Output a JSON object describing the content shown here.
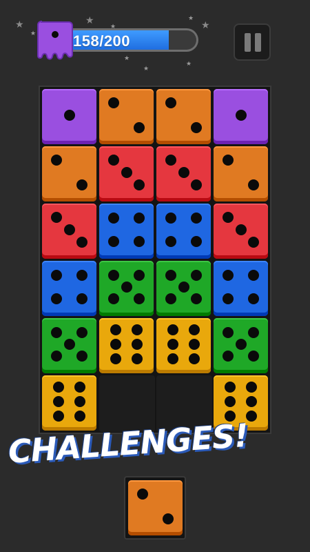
{
  "hud": {
    "progress_label": "158/200",
    "progress_current": 158,
    "progress_total": 200,
    "progress_color": "#2f86f5",
    "level_icon": "purple-jelly-die-icon",
    "pause_icon": "pause-icon"
  },
  "colors": {
    "purple": "#9a4fe0",
    "orange": "#e07a22",
    "red": "#e5373f",
    "blue": "#1f67e2",
    "green": "#1fa827",
    "yellow": "#e9a80c"
  },
  "board": {
    "columns": 4,
    "rows": [
      [
        {
          "color": "purple",
          "value": 1
        },
        {
          "color": "orange",
          "value": 2
        },
        {
          "color": "orange",
          "value": 2
        },
        {
          "color": "purple",
          "value": 1
        }
      ],
      [
        {
          "color": "orange",
          "value": 2
        },
        {
          "color": "red",
          "value": 3
        },
        {
          "color": "red",
          "value": 3
        },
        {
          "color": "orange",
          "value": 2
        }
      ],
      [
        {
          "color": "red",
          "value": 3
        },
        {
          "color": "blue",
          "value": 4
        },
        {
          "color": "blue",
          "value": 4
        },
        {
          "color": "red",
          "value": 3
        }
      ],
      [
        {
          "color": "blue",
          "value": 4
        },
        {
          "color": "green",
          "value": 5
        },
        {
          "color": "green",
          "value": 5
        },
        {
          "color": "blue",
          "value": 4
        }
      ],
      [
        {
          "color": "green",
          "value": 5
        },
        {
          "color": "yellow",
          "value": 6
        },
        {
          "color": "yellow",
          "value": 6
        },
        {
          "color": "green",
          "value": 5
        }
      ],
      [
        {
          "color": "yellow",
          "value": 6
        },
        null,
        null,
        {
          "color": "yellow",
          "value": 6
        }
      ]
    ]
  },
  "banner": {
    "text": "CHALLENGES!"
  },
  "next_die": {
    "color": "orange",
    "value": 2
  }
}
